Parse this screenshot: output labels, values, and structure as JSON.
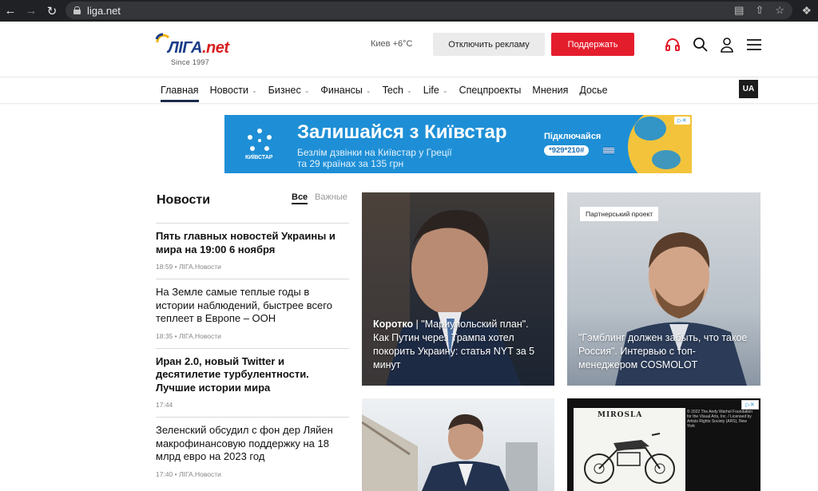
{
  "browser": {
    "url": "liga.net"
  },
  "header": {
    "logo_text": "ЛІГА",
    "logo_suffix": ".net",
    "since": "Since 1997",
    "weather": "Киев +6°C",
    "ads_button": "Отключить рекламу",
    "support_button": "Поддержать",
    "accent_color": "#e41d2d",
    "icons": [
      "headphones-icon",
      "search-icon",
      "user-icon",
      "menu-icon"
    ]
  },
  "nav": {
    "items": [
      {
        "label": "Главная",
        "active": true
      },
      {
        "label": "Новости",
        "dropdown": true
      },
      {
        "label": "Бизнес",
        "dropdown": true
      },
      {
        "label": "Финансы",
        "dropdown": true
      },
      {
        "label": "Tech",
        "dropdown": true
      },
      {
        "label": "Life",
        "dropdown": true
      },
      {
        "label": "Спецпроекты"
      },
      {
        "label": "Мнения"
      },
      {
        "label": "Досье"
      }
    ],
    "lang": "UA"
  },
  "banner": {
    "brand": "КИЇВСТАР",
    "headline": "Залишайся з Київстар",
    "sub_line1": "Безлім дзвінки на Київстар у Греції",
    "sub_line2": "та 29 країнах за 135 грн",
    "connect": "Підключайся",
    "code": "*929*210#"
  },
  "feed": {
    "title": "Новости",
    "tab_all": "Все",
    "tab_important": "Важные",
    "items": [
      {
        "title": "Пять главных новостей Украины и мира на 19:00 6 ноября",
        "time": "18:59 • ЛІГА.Новости",
        "bold": true
      },
      {
        "title": "На Земле самые теплые годы в истории наблюдений, быстрее всего теплеет в Европе – ООН",
        "time": "18:35 • ЛІГА.Новости",
        "bold": false
      },
      {
        "title": "Иран 2.0, новый Twitter и десятилетие турбулентности. Лучшие истории мира",
        "time": "17:44",
        "bold": true
      },
      {
        "title": "Зеленский обсудил с фон дер Ляйен макрофинансовую поддержку на 18 млрд евро на 2023 год",
        "time": "17:40 • ЛІГА.Новости",
        "bold": false
      }
    ]
  },
  "cards": {
    "main": {
      "prefix": "Коротко",
      "text": " | \"Мариупольский план\". Как Путин через Трампа хотел покорить Украину: статья NYT за 5 минут"
    },
    "partner": {
      "badge": "Партнерський проект",
      "text": "\"Гэмблинг должен забыть, что такое Россия\". Интервью с топ-менеджером COSMOLOT"
    },
    "ad_caption": "© 2022 The Andy Warhol Foundation for the Visual Arts, Inc. / Licensed by Artists Rights Society (ARS), New York",
    "ad_title": "MIROSLA"
  }
}
